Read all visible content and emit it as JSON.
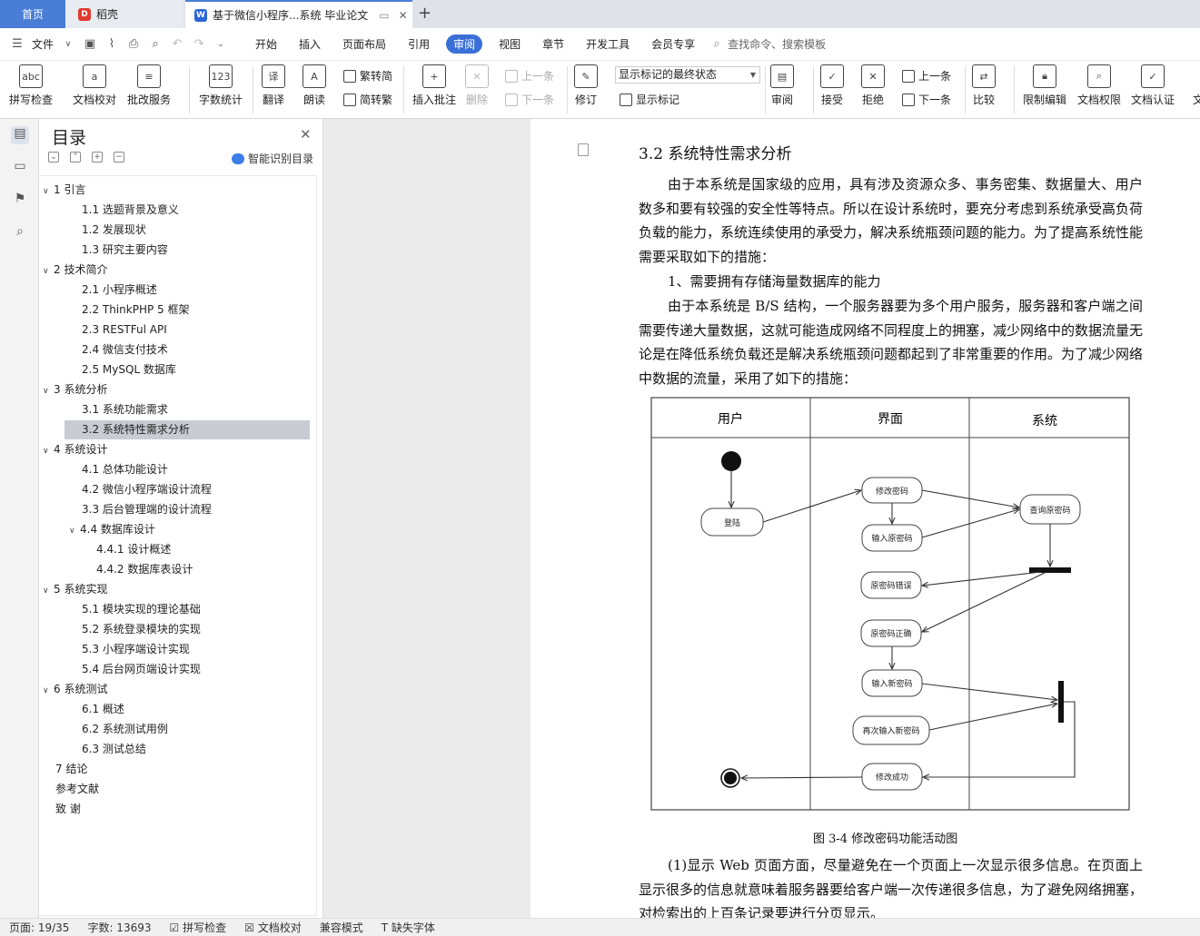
{
  "tabs": {
    "home": "首页",
    "daoke": "稻壳",
    "doc": "基于微信小程序...系统 毕业论文"
  },
  "colors": {
    "accent": "#3b6fd8",
    "brand_red": "#e03a2e",
    "selected": "#c8ccd2"
  },
  "menu": {
    "file": "文件",
    "items": [
      "开始",
      "插入",
      "页面布局",
      "引用",
      "审阅",
      "视图",
      "章节",
      "开发工具",
      "会员专享"
    ],
    "active": "审阅",
    "search": "查找命令、搜索模板"
  },
  "ribbon": {
    "spell": "拼写检查",
    "proof": "文档校对",
    "annot": "批改服务",
    "wordcount": "字数统计",
    "translate": "翻译",
    "read": "朗读",
    "trad": "繁转简",
    "simp": "简转繁",
    "insert_comment": "插入批注",
    "delete": "删除",
    "prev": "上一条",
    "next": "下一条",
    "track": "修订",
    "markup_select": "显示标记的最终状态",
    "show_markup": "显示标记",
    "review": "审阅",
    "accept": "接受",
    "reject": "拒绝",
    "prev2": "上一条",
    "next2": "下一条",
    "compare": "比较",
    "restrict": "限制编辑",
    "rights": "文档权限",
    "cert": "文档认证",
    "more": "文"
  },
  "toc": {
    "title": "目录",
    "smart": "智能识别目录",
    "items": [
      {
        "t": "1  引言",
        "l": 1,
        "c": "v"
      },
      {
        "t": "1.1  选题背景及意义",
        "l": 2
      },
      {
        "t": "1.2  发展现状",
        "l": 2
      },
      {
        "t": "1.3  研究主要内容",
        "l": 2
      },
      {
        "t": "2  技术简介",
        "l": 1,
        "c": "v"
      },
      {
        "t": "2.1  小程序概述",
        "l": 2
      },
      {
        "t": "2.2 ThinkPHP 5  框架",
        "l": 2
      },
      {
        "t": "2.3 RESTFul API",
        "l": 2
      },
      {
        "t": "2.4  微信支付技术",
        "l": 2
      },
      {
        "t": "2.5 MySQL 数据库",
        "l": 2
      },
      {
        "t": "3  系统分析",
        "l": 1,
        "c": "v"
      },
      {
        "t": "3.1  系统功能需求",
        "l": 2
      },
      {
        "t": "3.2  系统特性需求分析",
        "l": 2,
        "sel": true
      },
      {
        "t": "4  系统设计",
        "l": 1,
        "c": "v"
      },
      {
        "t": "4.1  总体功能设计",
        "l": 2
      },
      {
        "t": "4.2  微信小程序端设计流程",
        "l": 2
      },
      {
        "t": "3.3  后台管理端的设计流程",
        "l": 2
      },
      {
        "t": "4.4  数据库设计",
        "l": 2,
        "c": "v"
      },
      {
        "t": "4.4.1  设计概述",
        "l": 3
      },
      {
        "t": "4.4.2  数据库表设计",
        "l": 3
      },
      {
        "t": "5  系统实现",
        "l": 1,
        "c": "v"
      },
      {
        "t": "5.1  模块实现的理论基础",
        "l": 2
      },
      {
        "t": "5.2  系统登录模块的实现",
        "l": 2
      },
      {
        "t": "5.3  小程序端设计实现",
        "l": 2
      },
      {
        "t": "5.4  后台网页端设计实现",
        "l": 2
      },
      {
        "t": "6  系统测试",
        "l": 1,
        "c": "v"
      },
      {
        "t": "6.1  概述",
        "l": 2
      },
      {
        "t": "6.2  系统测试用例",
        "l": 2
      },
      {
        "t": "6.3  测试总结",
        "l": 2
      },
      {
        "t": "7  结论",
        "l": 1
      },
      {
        "t": "参考文献",
        "l": 1
      },
      {
        "t": "致    谢",
        "l": 1
      }
    ]
  },
  "doc": {
    "heading": "3.2  系统特性需求分析",
    "p1": "由于本系统是国家级的应用，具有涉及资源众多、事务密集、数据量大、用户数多和要有较强的安全性等特点。所以在设计系统时，要充分考虑到系统承受高负荷负载的能力，系统连续使用的承受力，解决系统瓶颈问题的能力。为了提高系统性能需要采取如下的措施：",
    "p2": "1、需要拥有存储海量数据库的能力",
    "p3": "由于本系统是 B/S 结构，一个服务器要为多个用户服务，服务器和客户端之间需要传递大量数据，这就可能造成网络不同程度上的拥塞，减少网络中的数据流量无论是在降低系统负载还是解决系统瓶颈问题都起到了非常重要的作用。为了减少网络中数据的流量，采用了如下的措施：",
    "caption": "图 3-4  修改密码功能活动图",
    "p4": "(1)显示 Web 页面方面，尽量避免在一个页面上一次显示很多信息。在页面上显示很多的信息就意味着服务器要给客户端一次传递很多信息，为了避免网络拥塞，对检索出的上百条记录要进行分页显示。"
  },
  "diagram": {
    "lanes": [
      "用户",
      "界面",
      "系统"
    ],
    "nodes": {
      "login": "登陆",
      "modify": "修改密码",
      "input_old": "输入原密码",
      "query": "查询原密码",
      "wrong": "原密码错误",
      "right": "原密码正确",
      "input_new": "输入新密码",
      "again": "再次输入新密码",
      "success": "修改成功"
    }
  },
  "status": {
    "page": "页面: 19/35",
    "words": "字数: 13693",
    "spell": "拼写检查",
    "proof": "文档校对",
    "compat": "兼容模式",
    "font": "缺失字体"
  }
}
